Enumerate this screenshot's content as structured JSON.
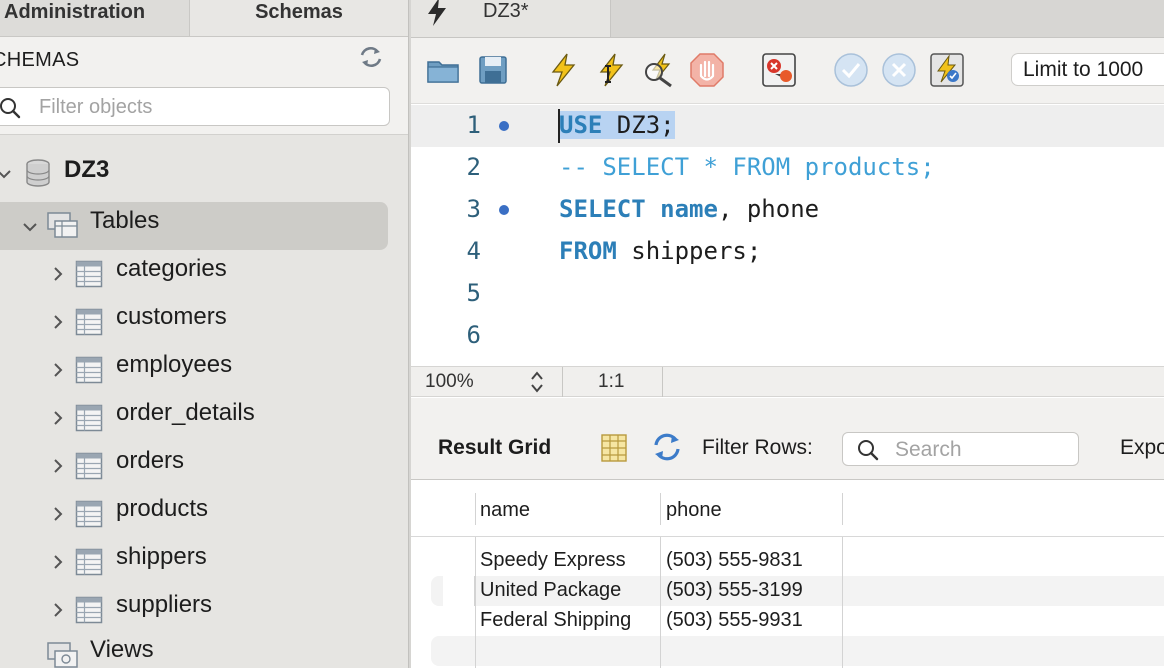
{
  "left_panel": {
    "tabs": {
      "administration": "Administration",
      "schemas": "Schemas"
    },
    "schemas_title": "CHEMAS",
    "filter_placeholder": "Filter objects",
    "database": "DZ3",
    "tables_label": "Tables",
    "tables": [
      "categories",
      "customers",
      "employees",
      "order_details",
      "orders",
      "products",
      "shippers",
      "suppliers"
    ],
    "views_label": "Views"
  },
  "editor": {
    "tab_label": "DZ3*",
    "limit_label": "Limit to 1000",
    "line_numbers": [
      "1",
      "2",
      "3",
      "4",
      "5",
      "6"
    ],
    "lines": {
      "l1_kw": "USE",
      "l1_rest": " DZ3;",
      "l2": "-- SELECT * FROM products;",
      "l3_kw1": "SELECT",
      "l3_kw2": "name",
      "l3_rest": ", phone",
      "l4_kw": "FROM",
      "l4_rest": " shippers;"
    },
    "zoom": "100%",
    "cursor_position": "1:1"
  },
  "result": {
    "grid_label": "Result Grid",
    "filter_rows_label": "Filter Rows:",
    "search_placeholder": "Search",
    "export_label": "Expo",
    "columns": [
      "name",
      "phone"
    ],
    "rows": [
      [
        "Speedy Express",
        "(503) 555-9831"
      ],
      [
        "United Package",
        "(503) 555-3199"
      ],
      [
        "Federal Shipping",
        "(503) 555-9931"
      ]
    ]
  },
  "colors": {
    "keyword": "#2c7fb8",
    "comment": "#3fa0d6",
    "selection": "#b8d3f2",
    "line_number": "#2d5f7a",
    "sidebar_bg": "#e6e5e2"
  },
  "icons": [
    "refresh-icon",
    "search-icon",
    "database-icon",
    "tables-folder-icon",
    "table-icon",
    "views-folder-icon",
    "lightning-icon",
    "open-folder-icon",
    "save-icon",
    "execute-icon",
    "execute-current-icon",
    "explain-icon",
    "stop-icon",
    "stop-on-error-icon",
    "commit-icon",
    "rollback-icon",
    "autocommit-icon",
    "form-editor-icon"
  ]
}
